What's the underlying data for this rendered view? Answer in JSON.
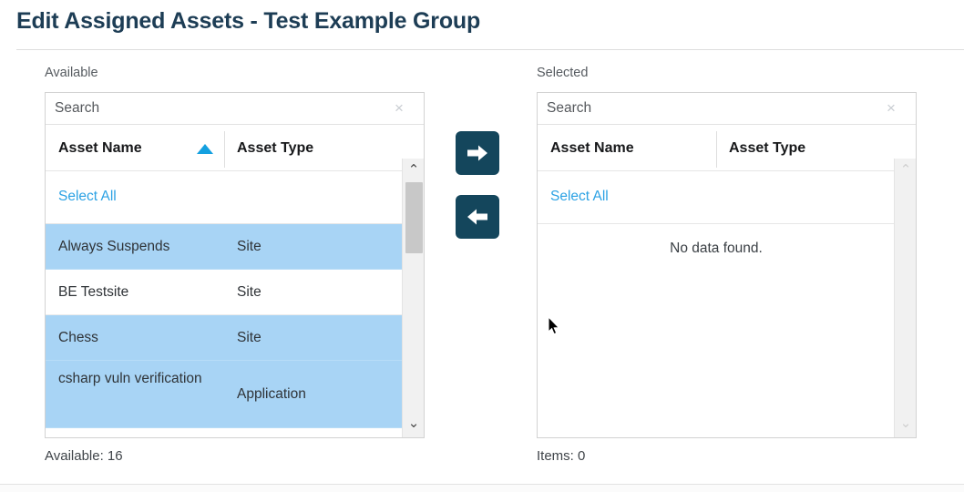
{
  "header": {
    "title": "Edit Assigned Assets - Test Example Group"
  },
  "colors": {
    "title": "#1d3d55",
    "accent_link": "#2ca2e4",
    "sort_arrow": "#14a0e0",
    "row_selected": "#a8d4f5",
    "transfer_button": "#14465c",
    "scrollbar_thumb": "#c8c8c8",
    "scrollbar_track": "#f1f1f1"
  },
  "available_panel": {
    "label": "Available",
    "search": {
      "placeholder": "Search",
      "value": "",
      "clear_icon": "close-icon",
      "clear_glyph": "×"
    },
    "columns": [
      {
        "key": "name",
        "label": "Asset Name",
        "sorted": true,
        "sort_direction": "asc",
        "sort_icon": "sort-ascending-icon"
      },
      {
        "key": "type",
        "label": "Asset Type",
        "sorted": false,
        "sort_direction": "",
        "sort_icon": ""
      }
    ],
    "select_all_label": "Select All",
    "rows": [
      {
        "name": "Always Suspends",
        "type": "Site",
        "selected": true,
        "tall": false
      },
      {
        "name": "BE Testsite",
        "type": "Site",
        "selected": false,
        "tall": false
      },
      {
        "name": "Chess",
        "type": "Site",
        "selected": true,
        "tall": false
      },
      {
        "name": "csharp vuln verification",
        "type": "Application",
        "selected": true,
        "tall": true
      }
    ],
    "scrollbar": {
      "up_icon": "chevron-up-icon",
      "down_icon": "chevron-down-icon",
      "up_glyph": "⌃",
      "down_glyph": "⌄",
      "active": true,
      "thumb_top_pct": 3,
      "thumb_height_pct": 22
    },
    "footer": "Available: 16"
  },
  "selected_panel": {
    "label": "Selected",
    "search": {
      "placeholder": "Search",
      "value": "",
      "clear_icon": "close-icon",
      "clear_glyph": "×"
    },
    "columns": [
      {
        "key": "name",
        "label": "Asset Name",
        "sorted": false,
        "sort_direction": "",
        "sort_icon": ""
      },
      {
        "key": "type",
        "label": "Asset Type",
        "sorted": false,
        "sort_direction": "",
        "sort_icon": ""
      }
    ],
    "select_all_label": "Select All",
    "rows": [],
    "empty_message": "No data found.",
    "scrollbar": {
      "up_icon": "chevron-up-icon",
      "down_icon": "chevron-down-icon",
      "up_glyph": "⌃",
      "down_glyph": "⌄",
      "active": false
    },
    "footer": "Items: 0"
  },
  "transfer": {
    "move_right": {
      "icon": "arrow-right-icon",
      "label": "Move to Selected"
    },
    "move_left": {
      "icon": "arrow-left-icon",
      "label": "Move to Available"
    }
  }
}
